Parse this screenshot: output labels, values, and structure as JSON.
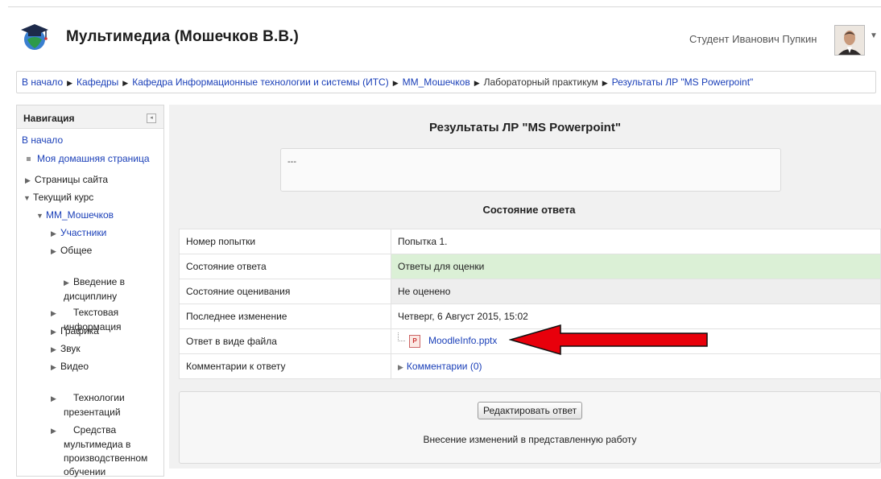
{
  "header": {
    "site_title": "Мультимедиа (Мошечков В.В.)",
    "user_name": "Студент Иванович Пупкин"
  },
  "breadcrumb": [
    {
      "label": "В начало",
      "link": true
    },
    {
      "label": "Кафедры",
      "link": true
    },
    {
      "label": "Кафедра Информационные технологии и системы (ИТС)",
      "link": true
    },
    {
      "label": "ММ_Мошечков",
      "link": true
    },
    {
      "label": "Лабораторный практикум",
      "link": false
    },
    {
      "label": "Результаты ЛР \"MS Powerpoint\"",
      "link": true
    }
  ],
  "nav": {
    "title": "Навигация",
    "home": "В начало",
    "my_home": "Моя домашняя страница",
    "site_pages": "Страницы сайта",
    "current_course": "Текущий курс",
    "course": "ММ_Мошечков",
    "sections": [
      {
        "label": "Участники"
      },
      {
        "label": "Общее"
      },
      {
        "label": "Введение в\nдисциплину"
      },
      {
        "label": "Текстовая\nинформация"
      },
      {
        "label": "Графика"
      },
      {
        "label": "Звук"
      },
      {
        "label": "Видео"
      },
      {
        "label": "Технологии\nпрезентаций"
      },
      {
        "label": "Средства\nмультимедиа в\nпроизводственном\nобучении"
      }
    ]
  },
  "main": {
    "title": "Результаты ЛР \"MS Powerpoint\"",
    "intro_text": "---",
    "section_title": "Состояние ответа",
    "rows": [
      {
        "label": "Номер попытки",
        "value": "Попытка 1."
      },
      {
        "label": "Состояние ответа",
        "value": "Ответы для оценки"
      },
      {
        "label": "Состояние оценивания",
        "value": "Не оценено"
      },
      {
        "label": "Последнее изменение",
        "value": "Четверг, 6 Август 2015, 15:02"
      },
      {
        "label": "Ответ в виде файла",
        "value": "MoodleInfo.pptx"
      },
      {
        "label": "Комментарии к ответу",
        "value": "Комментарии (0)"
      }
    ],
    "edit_button": "Редактировать ответ",
    "edit_note": "Внесение изменений в представленную работу"
  },
  "colors": {
    "link": "#1a3fb8",
    "graded_row_bg": "#dbf0d6",
    "grading_row_bg": "#eeeeee",
    "arrow_fill": "#e8000b"
  },
  "icons": [
    "mortarboard-logo-icon",
    "pptx-file-icon",
    "chevron-down-icon",
    "arrow-annotation"
  ]
}
